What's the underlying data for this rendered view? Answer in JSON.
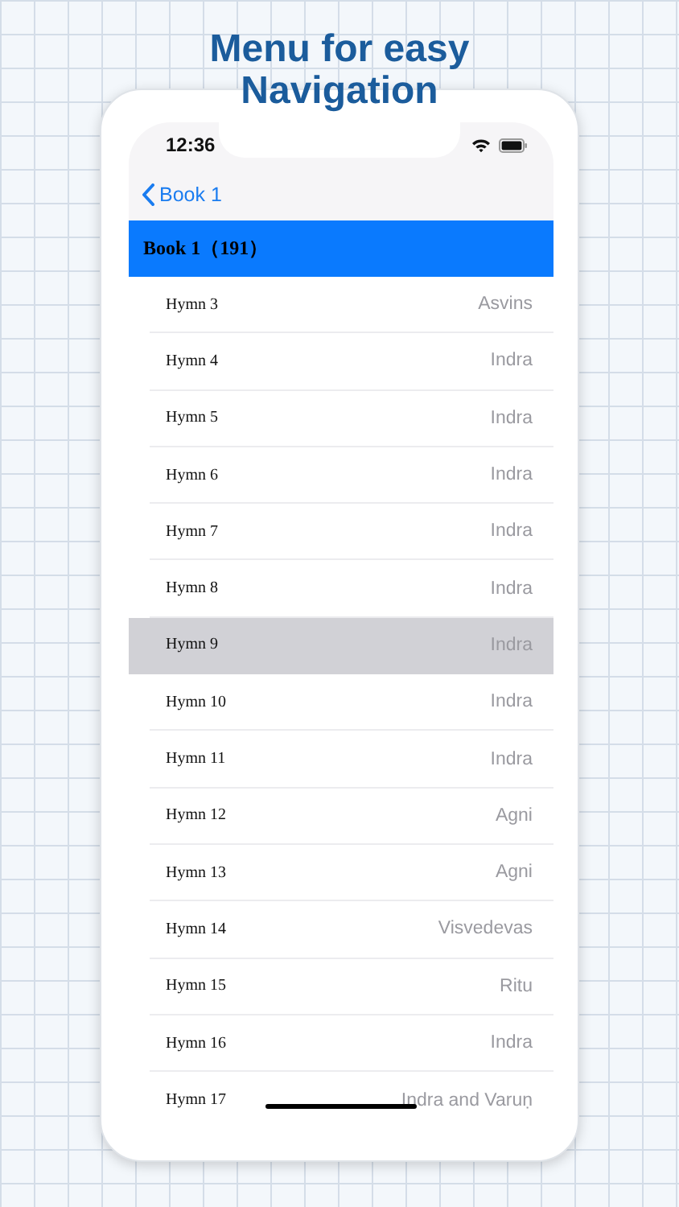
{
  "headline": "Menu for easy Navigation",
  "status_bar": {
    "time": "12:36"
  },
  "nav_bar": {
    "back_label": "Book 1"
  },
  "section_header": "Book 1（191）",
  "rows": [
    {
      "label": "Hymn 3",
      "deity": "Asvins",
      "selected": false
    },
    {
      "label": "Hymn 4",
      "deity": "Indra",
      "selected": false
    },
    {
      "label": "Hymn 5",
      "deity": "Indra",
      "selected": false
    },
    {
      "label": "Hymn 6",
      "deity": "Indra",
      "selected": false
    },
    {
      "label": "Hymn 7",
      "deity": "Indra",
      "selected": false
    },
    {
      "label": "Hymn 8",
      "deity": "Indra",
      "selected": false
    },
    {
      "label": "Hymn 9",
      "deity": "Indra",
      "selected": true
    },
    {
      "label": "Hymn 10",
      "deity": "Indra",
      "selected": false
    },
    {
      "label": "Hymn 11",
      "deity": "Indra",
      "selected": false
    },
    {
      "label": "Hymn 12",
      "deity": "Agni",
      "selected": false
    },
    {
      "label": "Hymn 13",
      "deity": "Agni",
      "selected": false
    },
    {
      "label": "Hymn 14",
      "deity": "Visvedevas",
      "selected": false
    },
    {
      "label": "Hymn 15",
      "deity": "Ritu",
      "selected": false
    },
    {
      "label": "Hymn 16",
      "deity": "Indra",
      "selected": false
    },
    {
      "label": "Hymn 17",
      "deity": "Indra and Varuṇ",
      "selected": false
    }
  ]
}
